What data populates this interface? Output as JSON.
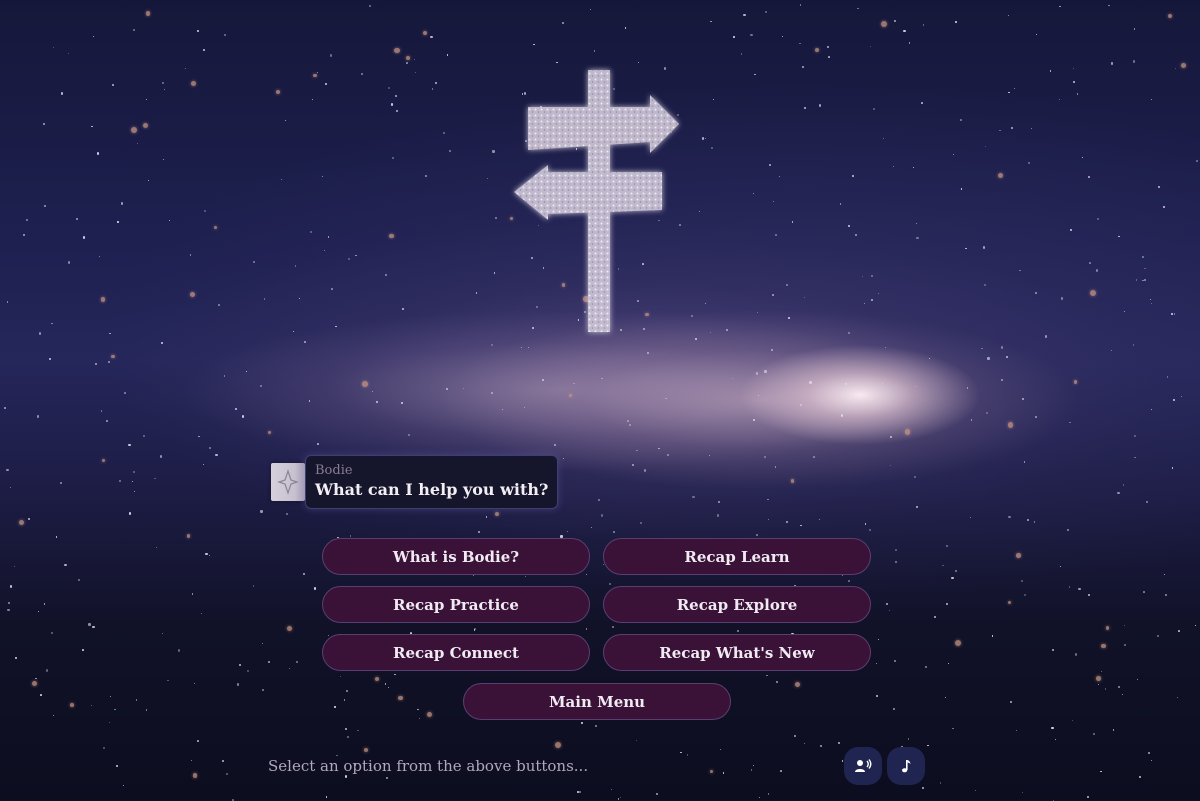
{
  "assistant": {
    "name": "Bodie",
    "message": "What can I help you with?",
    "avatar_icon": "sparkle-diamond-icon"
  },
  "options": [
    {
      "label": "What is Bodie?"
    },
    {
      "label": "Recap Learn"
    },
    {
      "label": "Recap Practice"
    },
    {
      "label": "Recap Explore"
    },
    {
      "label": "Recap Connect"
    },
    {
      "label": "Recap What's New"
    },
    {
      "label": "Main Menu"
    }
  ],
  "input": {
    "placeholder": "Select an option from the above buttons...",
    "value": ""
  },
  "controls": {
    "voice_icon": "speaker-person-icon",
    "music_icon": "music-note-icon"
  },
  "background": {
    "scene": "starry night sky with milky way and glowing signpost"
  },
  "colors": {
    "button_bg": "#3a1238",
    "button_border": "#5b3e70",
    "bubble_bg": "#15152b",
    "icon_button_bg": "#1f2550"
  }
}
